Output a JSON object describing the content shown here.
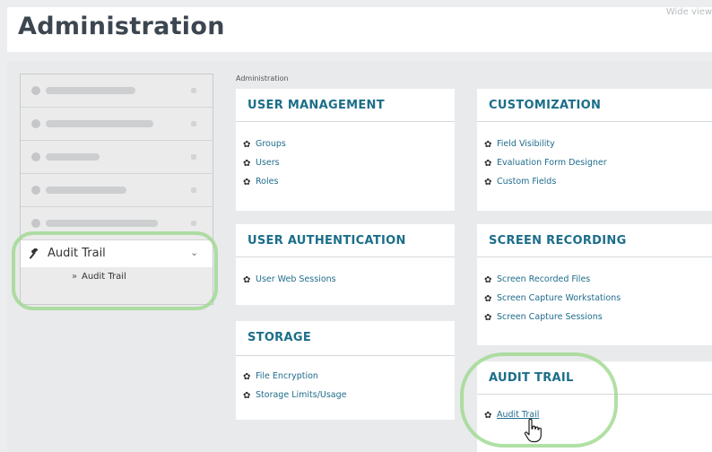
{
  "header": {
    "title": "Administration",
    "wide_view": "Wide view"
  },
  "sidebar": {
    "active_item": {
      "label": "Audit Trail",
      "icon": "gavel-icon"
    },
    "sub_item": {
      "arrow": "»",
      "label": "Audit Trail"
    }
  },
  "breadcrumb": "Administration",
  "cards": {
    "user_management": {
      "title": "USER MANAGEMENT",
      "links": [
        "Groups",
        "Users",
        "Roles"
      ]
    },
    "customization": {
      "title": "CUSTOMIZATION",
      "links": [
        "Field Visibility",
        "Evaluation Form Designer",
        "Custom Fields"
      ]
    },
    "user_authentication": {
      "title": "USER AUTHENTICATION",
      "links": [
        "User Web Sessions"
      ]
    },
    "screen_recording": {
      "title": "SCREEN RECORDING",
      "links": [
        "Screen Recorded Files",
        "Screen Capture Workstations",
        "Screen Capture Sessions"
      ]
    },
    "storage": {
      "title": "STORAGE",
      "links": [
        "File Encryption",
        "Storage Limits/Usage"
      ]
    },
    "audit_trail": {
      "title": "AUDIT TRAIL",
      "links": [
        "Audit Trail"
      ]
    }
  },
  "icons": {
    "link_bullet": "gear-icon",
    "pointer": "hand-cursor-icon"
  },
  "colors": {
    "accent": "#1c6e8a",
    "highlight_ring": "#9ed88f"
  }
}
